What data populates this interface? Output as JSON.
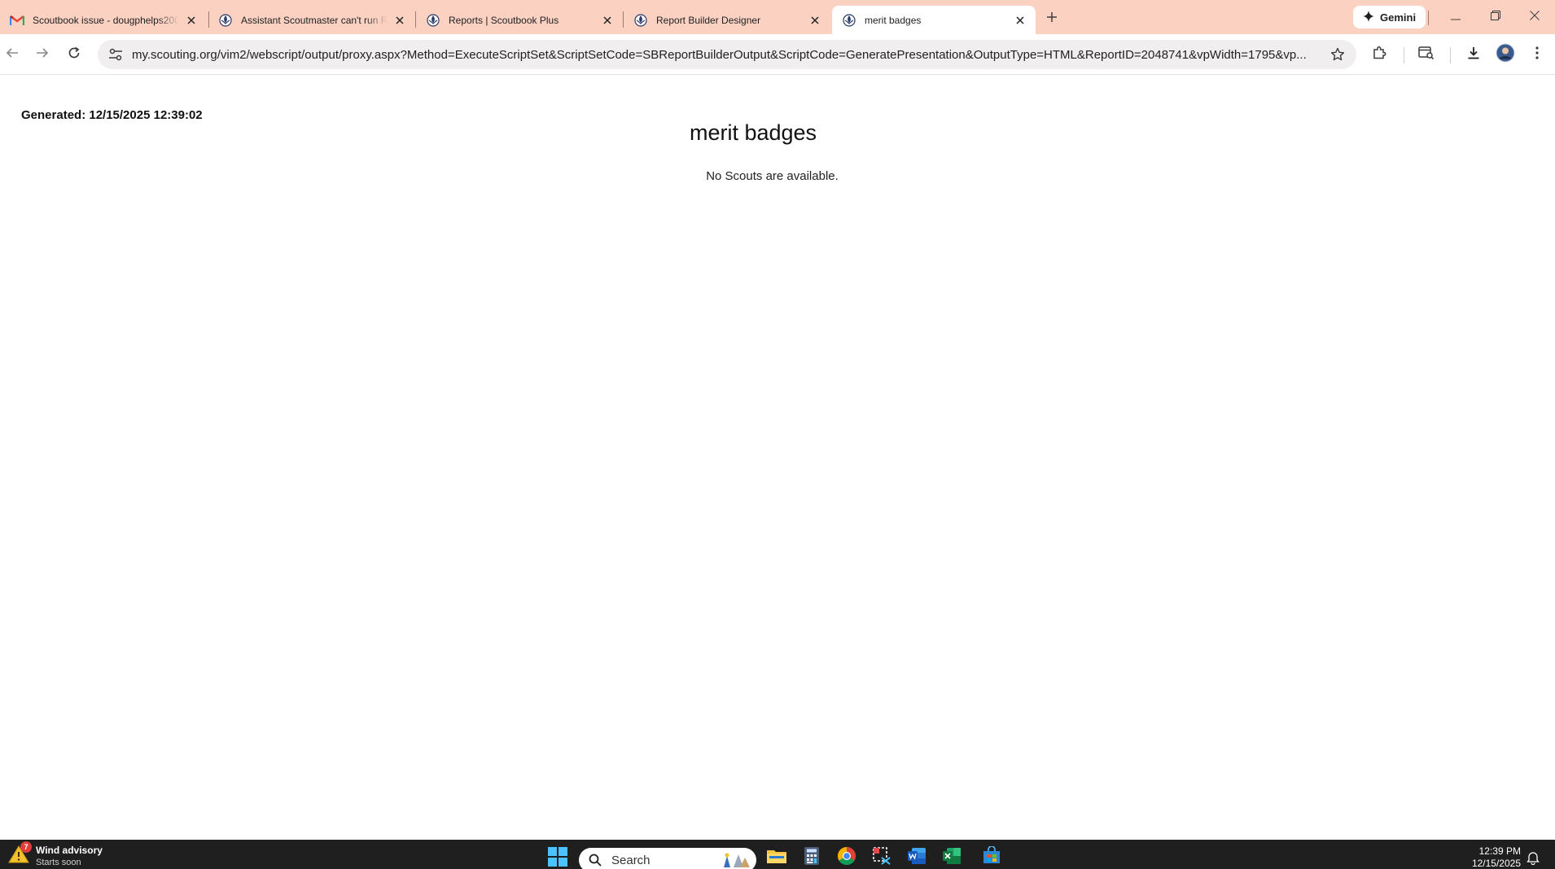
{
  "browser": {
    "tabs": [
      {
        "title": "Scoutbook issue - dougphelps200",
        "icon": "gmail-icon",
        "active": false
      },
      {
        "title": "Assistant Scoutmaster can't run Re",
        "icon": "scouting-fleur-icon",
        "active": false
      },
      {
        "title": "Reports | Scoutbook Plus",
        "icon": "scouting-fleur-icon",
        "active": false
      },
      {
        "title": "Report Builder Designer",
        "icon": "scouting-fleur-icon",
        "active": false
      },
      {
        "title": "merit badges",
        "icon": "scouting-fleur-icon",
        "active": true
      }
    ],
    "gemini_label": "Gemini",
    "url": {
      "host": "my.scouting.org",
      "path": "/vim2/webscript/output/proxy.aspx?Method=ExecuteScriptSet&ScriptSetCode=SBReportBuilderOutput&ScriptCode=GeneratePresentation&OutputType=HTML&ReportID=2048741&vpWidth=1795&vp..."
    }
  },
  "page": {
    "generated": "Generated: 12/15/2025 12:39:02",
    "title": "merit badges",
    "message": "No Scouts are available."
  },
  "taskbar": {
    "weather": {
      "title": "Wind advisory",
      "subtitle": "Starts soon",
      "badge": "7"
    },
    "search_placeholder": "Search",
    "clock": {
      "time": "12:39 PM",
      "date": "12/15/2025"
    }
  },
  "colors": {
    "tabstrip": "#fbd2c2",
    "taskbar": "#1f1f1f",
    "omnibox": "#f0eeee"
  }
}
